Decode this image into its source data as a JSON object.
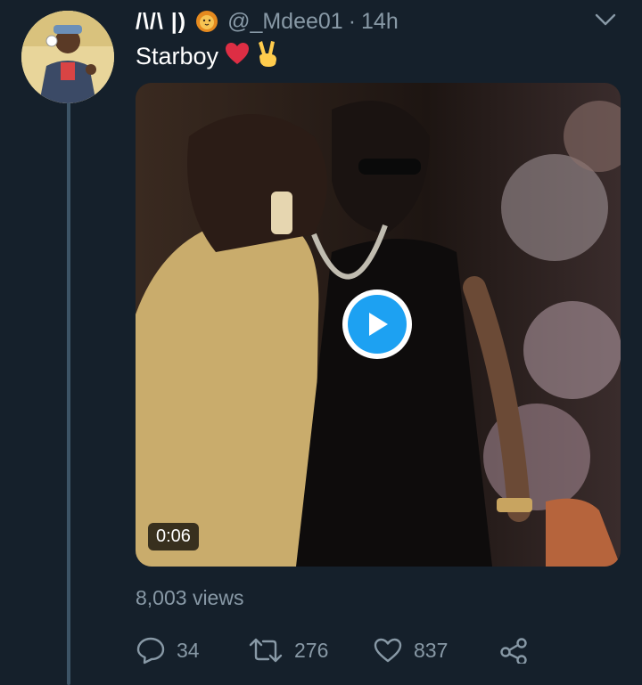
{
  "tweet": {
    "display_name": "/\\/\\ |)",
    "handle": "@_Mdee01",
    "separator": "·",
    "time": "14h",
    "text": "Starboy",
    "text_emojis": [
      "red-heart",
      "victory-hand"
    ],
    "name_emoji": "lion-face"
  },
  "video": {
    "duration": "0:06"
  },
  "stats": {
    "views": "8,003 views",
    "replies": "34",
    "retweets": "276",
    "likes": "837"
  },
  "colors": {
    "background": "#15202b",
    "secondary_text": "#8899a6",
    "accent": "#1da1f2",
    "thread_line": "#3d5466"
  }
}
